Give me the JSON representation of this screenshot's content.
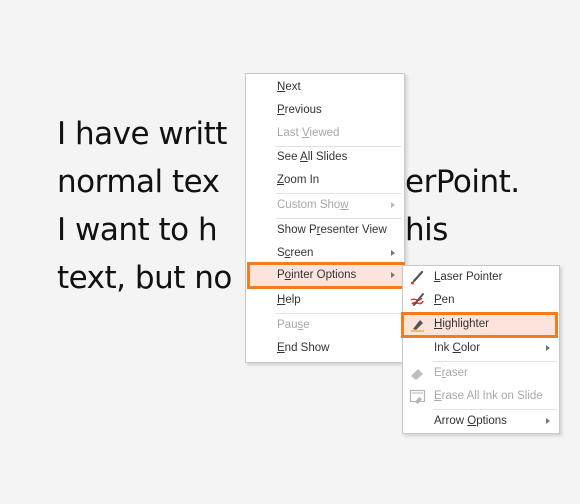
{
  "slide": {
    "lines": [
      "I have written",
      "normal text in PowerPoint.",
      "I want to highlight this",
      "text, but not"
    ],
    "visible_lines": [
      "I have writt",
      "normal tex",
      "I want to h",
      "text, but no"
    ],
    "right_fragments": [
      "erPoint.",
      "his"
    ]
  },
  "context_menu": {
    "items": [
      {
        "label": "Next",
        "key": "N",
        "disabled": false
      },
      {
        "label": "Previous",
        "key": "P",
        "disabled": false
      },
      {
        "label": "Last Viewed",
        "key": "V",
        "disabled": true
      },
      {
        "label": "See All Slides",
        "key": "A",
        "disabled": false
      },
      {
        "label": "Zoom In",
        "key": "Z",
        "disabled": false
      },
      {
        "label": "Custom Show",
        "key": "w",
        "disabled": true,
        "submenu": true
      },
      {
        "label": "Show Presenter View",
        "key": "r",
        "disabled": false
      },
      {
        "label": "Screen",
        "key": "c",
        "disabled": false,
        "submenu": true
      },
      {
        "label": "Pointer Options",
        "key": "o",
        "disabled": false,
        "submenu": true,
        "highlighted": true
      },
      {
        "label": "Help",
        "key": "H",
        "disabled": false
      },
      {
        "label": "Pause",
        "key": "s",
        "disabled": true
      },
      {
        "label": "End Show",
        "key": "E",
        "disabled": false
      }
    ]
  },
  "pointer_submenu": {
    "items": [
      {
        "label": "Laser Pointer",
        "key": "L",
        "icon": "laser-pointer-icon",
        "disabled": false
      },
      {
        "label": "Pen",
        "key": "P",
        "icon": "pen-icon",
        "disabled": false
      },
      {
        "label": "Highlighter",
        "key": "H",
        "icon": "highlighter-icon",
        "disabled": false,
        "highlighted": true
      },
      {
        "label": "Ink Color",
        "key": "C",
        "disabled": false,
        "submenu": true
      },
      {
        "label": "Eraser",
        "key": "r",
        "icon": "eraser-icon",
        "disabled": true
      },
      {
        "label": "Erase All Ink on Slide",
        "key": "E",
        "icon": "erase-all-icon",
        "disabled": true
      },
      {
        "label": "Arrow Options",
        "key": "O",
        "disabled": false,
        "submenu": true
      }
    ]
  },
  "colors": {
    "highlight_border": "#f47b20",
    "highlight_fill": "#fce4dc",
    "disabled_text": "#a8a8a8",
    "text": "#333333"
  }
}
